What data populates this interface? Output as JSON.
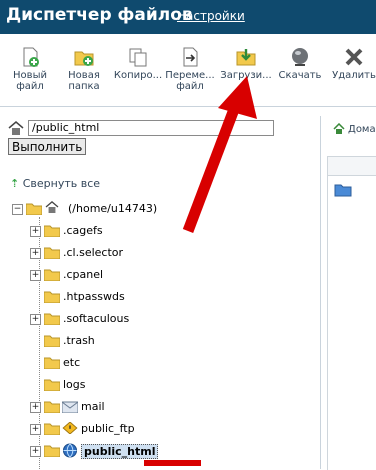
{
  "header": {
    "title": "Диспетчер файлов",
    "settings_link": "Настройки"
  },
  "toolbar": [
    {
      "label": "Новый файл",
      "icon": "new-file-icon"
    },
    {
      "label": "Новая папка",
      "icon": "new-folder-icon"
    },
    {
      "label": "Копиро...",
      "icon": "copy-icon"
    },
    {
      "label": "Переме... файл",
      "icon": "move-file-icon"
    },
    {
      "label": "Загрузи...",
      "icon": "upload-icon"
    },
    {
      "label": "Скачать",
      "icon": "download-icon"
    },
    {
      "label": "Удалить",
      "icon": "delete-icon"
    }
  ],
  "path": {
    "value": "/public_html",
    "execute_label": "Выполнить"
  },
  "right_panel": {
    "tab_label": "Дома"
  },
  "tree": {
    "collapse_label": "Свернуть все",
    "root_label": "(/home/u14743)",
    "items": [
      {
        "label": ".cagefs",
        "expandable": true
      },
      {
        "label": ".cl.selector",
        "expandable": true
      },
      {
        "label": ".cpanel",
        "expandable": true
      },
      {
        "label": ".htpasswds",
        "expandable": false
      },
      {
        "label": ".softaculous",
        "expandable": true
      },
      {
        "label": ".trash",
        "expandable": false
      },
      {
        "label": "etc",
        "expandable": false
      },
      {
        "label": "logs",
        "expandable": false
      },
      {
        "label": "mail",
        "expandable": true
      },
      {
        "label": "public_ftp",
        "expandable": true
      },
      {
        "label": "public_html",
        "expandable": true,
        "selected": true
      }
    ]
  },
  "colors": {
    "header_bg": "#0f4a6e",
    "accent_red": "#d80000",
    "folder_yellow": "#f2c94c"
  }
}
